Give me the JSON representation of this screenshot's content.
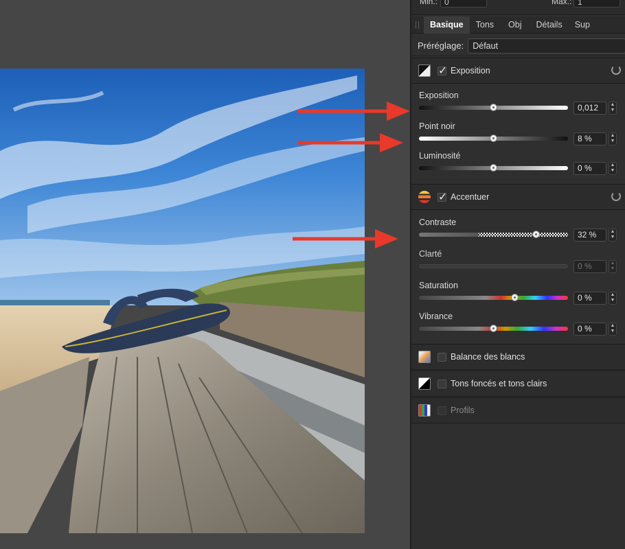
{
  "topbar": {
    "min_label": "Min.:",
    "min_value": "0",
    "max_label": "Max.:",
    "max_value": "1"
  },
  "tabs": [
    {
      "label": "Basique"
    },
    {
      "label": "Tons"
    },
    {
      "label": "Obj"
    },
    {
      "label": "Détails"
    },
    {
      "label": "Sup"
    }
  ],
  "preset": {
    "label": "Préréglage:",
    "value": "Défaut"
  },
  "exposure_section": {
    "title": "Exposition",
    "params": [
      {
        "label": "Exposition",
        "value": "0,012",
        "level": 0.5
      },
      {
        "label": "Point noir",
        "value": "8 %",
        "level": 0.5
      },
      {
        "label": "Luminosité",
        "value": "0 %",
        "level": 0.5
      }
    ]
  },
  "enhance_section": {
    "title": "Accentuer",
    "params": [
      {
        "label": "Contraste",
        "value": "32 %",
        "level": 0.8
      },
      {
        "label": "Clarté",
        "value": "0 %",
        "level": 0.0
      },
      {
        "label": "Saturation",
        "value": "0 %",
        "level": 0.65
      },
      {
        "label": "Vibrance",
        "value": "0 %",
        "level": 0.5
      }
    ]
  },
  "other_sections": [
    {
      "title": "Balance des blancs"
    },
    {
      "title": "Tons foncés et tons clairs"
    },
    {
      "title": "Profils"
    }
  ],
  "colors": {
    "arrow": "#e8392b",
    "panel": "#2f2f2f"
  }
}
